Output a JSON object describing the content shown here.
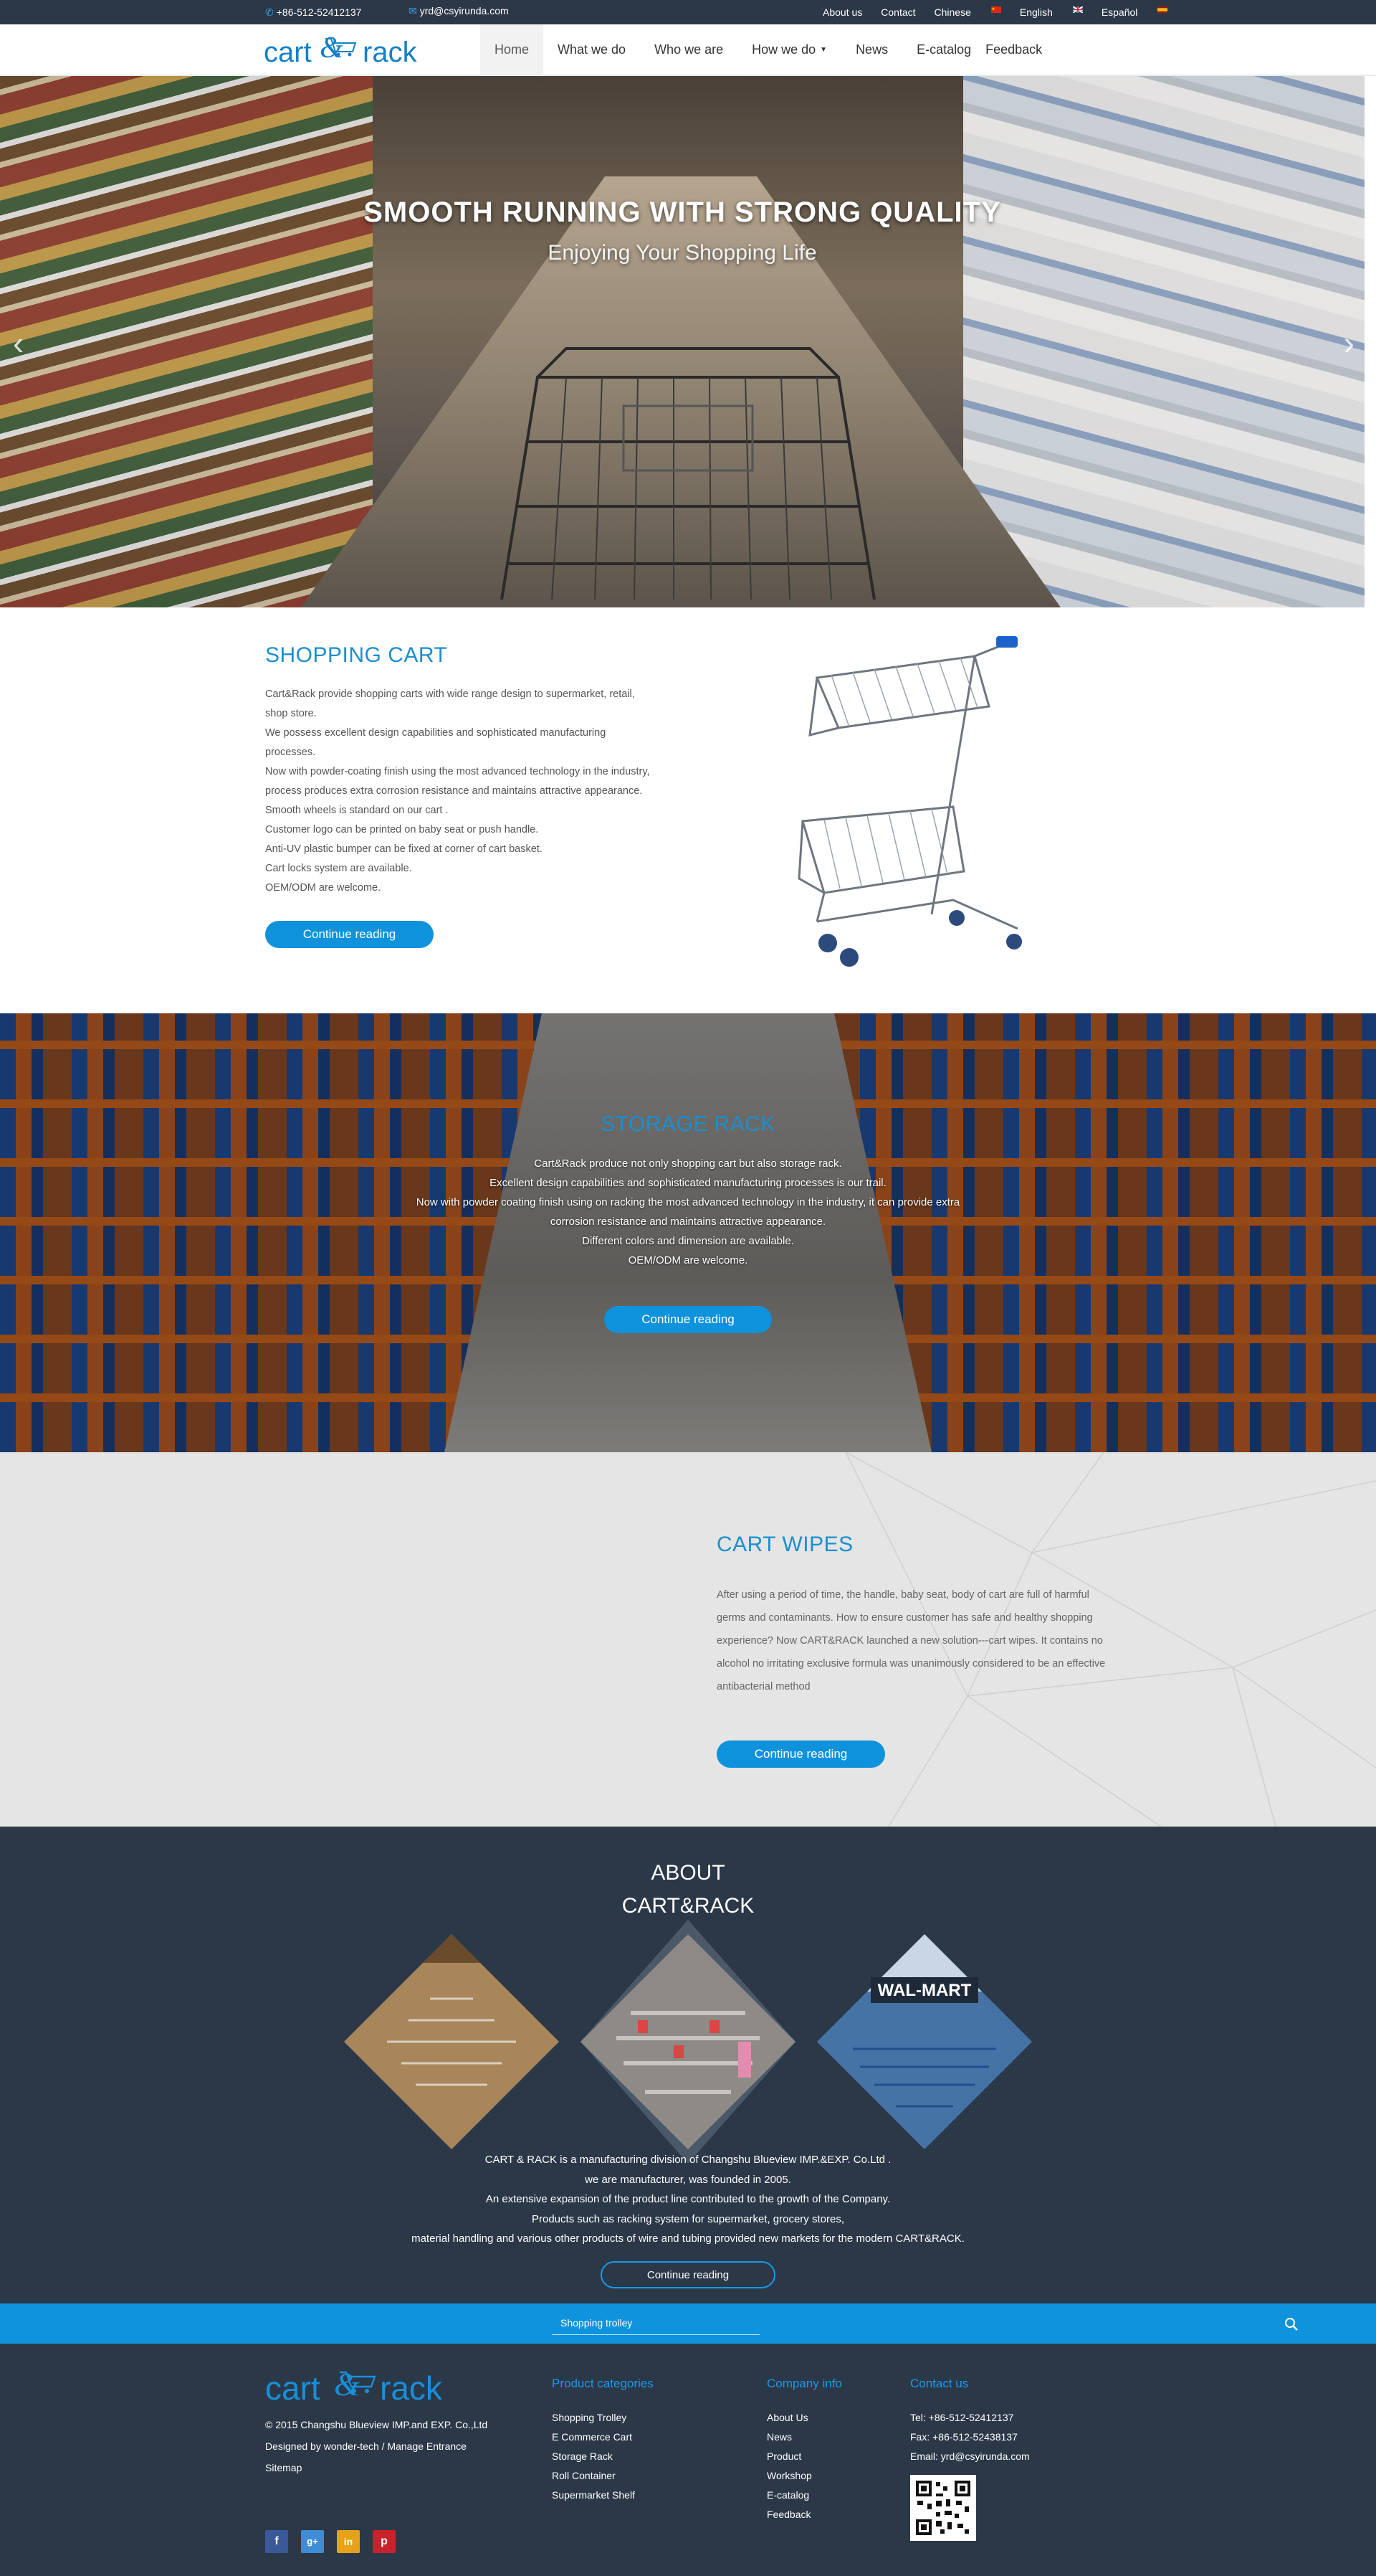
{
  "topbar": {
    "phone": "+86-512-52412137",
    "email": "yrd@csyirunda.com",
    "links": [
      "About us",
      "Contact",
      "Chinese",
      "English",
      "Español"
    ]
  },
  "header": {
    "logo_text": "cart&rack",
    "nav": [
      {
        "label": "Home",
        "active": true
      },
      {
        "label": "What we do"
      },
      {
        "label": "Who we are"
      },
      {
        "label": "How we do",
        "dropdown": true
      },
      {
        "label": "News"
      },
      {
        "label": "E-catalog"
      },
      {
        "label": "Feedback"
      }
    ]
  },
  "hero": {
    "headline": "SMOOTH RUNNING WITH STRONG QUALITY",
    "subline": "Enjoying Your Shopping Life"
  },
  "shopping_cart": {
    "title": "SHOPPING CART",
    "lines": [
      "Cart&Rack provide shopping carts with wide range design to supermarket, retail,",
      "shop store.",
      "We possess excellent design capabilities and sophisticated manufacturing",
      "processes.",
      "Now with powder-coating finish using the most advanced technology in the industry,",
      "process produces extra corrosion resistance and maintains attractive appearance.",
      "Smooth wheels is  standard on our cart .",
      "Customer logo can be printed on baby seat or push handle.",
      "Anti-UV plastic bumper can be fixed at corner of cart basket.",
      "Cart locks system are available.",
      "OEM/ODM are welcome."
    ],
    "button": "Continue reading"
  },
  "storage_rack": {
    "title": "STORAGE RACK",
    "lines": [
      "Cart&Rack produce not only shopping cart but also storage rack.",
      "Excellent design capabilities and sophisticated manufacturing processes is our trail.",
      "Now with powder coating finish using on racking the most advanced technology in the industry, it can provide extra",
      "corrosion resistance and maintains attractive appearance.",
      "Different colors and dimension are available.",
      "OEM/ODM are welcome."
    ],
    "button": "Continue reading"
  },
  "cart_wipes": {
    "title": "CART WIPES",
    "lines": [
      "After using a period of time, the handle, baby seat, body of cart are full of harmful",
      "germs and contaminants. How to ensure customer has safe and healthy shopping",
      "experience? Now CART&RACK launched a new solution---cart wipes. It contains no",
      "alcohol no irritating exclusive formula was unanimously considered to be an effective",
      "antibacterial method"
    ],
    "button": "Continue reading"
  },
  "about": {
    "title_line1": "ABOUT",
    "title_line2": "CART&RACK",
    "lines": [
      "CART & RACK is a manufacturing division of Changshu Blueview IMP.&EXP. Co.Ltd .",
      "we are manufacturer, was founded in 2005.",
      "An extensive expansion of the product line contributed to the growth of the Company.",
      "Products such as racking system for supermarket, grocery stores,",
      "material handling and various other products of wire and tubing provided new markets for the modern CART&RACK."
    ],
    "button": "Continue reading",
    "store_sign": "WAL-MART"
  },
  "search": {
    "placeholder": "Shopping trolley"
  },
  "footer": {
    "copyright": "© 2015    Changshu Blueview IMP.and EXP. Co.,Ltd",
    "designed": "Designed by wonder-tech / Manage Entrance",
    "sitemap": "Sitemap",
    "product_categories": {
      "title": "Product categories",
      "items": [
        "Shopping Trolley",
        "E Commerce Cart",
        "Storage Rack",
        "Roll Container",
        "Supermarket Shelf"
      ]
    },
    "company_info": {
      "title": "Company info",
      "items": [
        "About Us",
        "News",
        "Product",
        "Workshop",
        "E-catalog",
        "Feedback"
      ]
    },
    "contact": {
      "title": "Contact us",
      "items": [
        "Tel: +86-512-52412137",
        "Fax: +86-512-52438137",
        "Email: yrd@csyirunda.com"
      ]
    },
    "social": [
      {
        "icon": "facebook-icon",
        "glyph": "f",
        "color": "#3b5998"
      },
      {
        "icon": "google-plus-icon",
        "glyph": "g+",
        "color": "#3f8bd5"
      },
      {
        "icon": "linkedin-icon",
        "glyph": "in",
        "color": "#e6a21b"
      },
      {
        "icon": "pinterest-icon",
        "glyph": "p",
        "color": "#c8232c"
      }
    ]
  },
  "colors": {
    "accent": "#0f93dc",
    "dark": "#2b3848",
    "heading_blue": "#1a8fd0"
  }
}
